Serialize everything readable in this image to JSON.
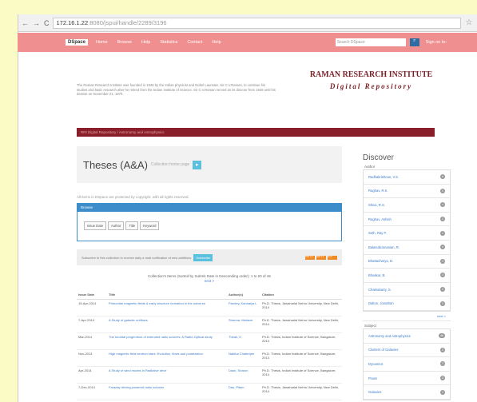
{
  "browser": {
    "host": "172.16.1.22",
    "path": ":8080/jspui/handle/2289/3196"
  },
  "navbar": {
    "logo": "DSpace",
    "links": [
      "Home",
      "Browse",
      "Help",
      "Statistics",
      "Contact",
      "Help"
    ],
    "search_placeholder": "Search DSpace",
    "signin": "Sign on to:"
  },
  "intro": {
    "text": "The Raman Research Institute was founded in 1948 by the Indian physicist and Nobel Laureate, Sir C.V.Raman, to continue his studies and basic research after he retired from the Indian Institute of Science. Sir C.V.Raman served as its director from 1948 until his demise on November 21, 1970."
  },
  "brand": {
    "line1": "RAMAN RESEARCH INSTITUTE",
    "line2": "Digital Repository"
  },
  "breadcrumb": "RRI Digital Repository / Astronomy and Astrophysics",
  "collection": {
    "title": "Theses (A&A)",
    "subtitle": "Collection home page"
  },
  "notice": "All items in DSpace are protected by copyright, with all rights reserved.",
  "browse": {
    "header": "Browse",
    "buttons": [
      "Issue Date",
      "Author",
      "Title",
      "Keyword"
    ]
  },
  "subscribe": {
    "text": "Subscribe to this collection to receive daily e-mail notification of new additions",
    "button": "Subscribe",
    "feeds": [
      "RSS 1.0",
      "RSS 2.0",
      "Atom"
    ]
  },
  "listing": {
    "summary": "Collection's Items (Sorted by Submit Date in Descending order): 1 to 20 of 46",
    "next": "next >"
  },
  "table": {
    "headers": [
      "Issue Date",
      "Title",
      "Author(s)",
      "Citation"
    ],
    "rows": [
      [
        "15-Apr-2014",
        "Primordial magnetic fields & early structure formation in the universe",
        "Pandey, Kanhaiya L",
        "Ph.D. Thesis, Jawaharlal Nehru University, New Delhi, 2014"
      ],
      [
        "7-Apr-2014",
        "A Study of galactic outflows",
        "Sharma, Mahavir",
        "Ph.D. Thesis, Jawaharlal Nehru University, New Delhi, 2014"
      ],
      [
        "Mar-2014",
        "The toroidal progenitors of extended radio sources: A Radio-Optical study",
        "Thirak, K.",
        "Ph.D. Thesis, Indian Institute of Science, Bangalore, 2014"
      ],
      [
        "Nov-2013",
        "High magnetic field neutron stars: Evolution, flows and polarization",
        "Nabiha Chatterjee",
        "Ph.D. Thesis, Indian Institute of Science, Bangalore, 2013"
      ],
      [
        "Apr-2014",
        "A Study of wind modes in Radiative drive",
        "Dash, Sharon",
        "Ph.D. Thesis, Indian Institute of Science, Bangalore, 2014"
      ],
      [
        "7-Dec-2014",
        "Faraday driving powered radio sources",
        "Das, Pitam",
        "Ph.D. Thesis, Jawaharlal Nehru University, New Delhi, 2014"
      ]
    ]
  },
  "discover": {
    "heading": "Discover",
    "author_label": "Author",
    "authors": [
      {
        "name": "Radhakrishnan, V.S.",
        "count": "6"
      },
      {
        "name": "Raghav, R.K.",
        "count": "5"
      },
      {
        "name": "Shiva, R.S.",
        "count": "4"
      },
      {
        "name": "Raghav, Ashish",
        "count": "4"
      },
      {
        "name": "Seth, Ray P.",
        "count": "4"
      },
      {
        "name": "Balasubramanian, R.",
        "count": "4"
      },
      {
        "name": "Bhattacharya, D.",
        "count": "3"
      },
      {
        "name": "Bhaskar, B.",
        "count": "3"
      },
      {
        "name": "Chakrabarty, S.",
        "count": "3"
      },
      {
        "name": "Dalton, Jonathan",
        "count": "3"
      }
    ],
    "more": "next >",
    "subject_label": "Subject",
    "subjects": [
      {
        "name": "Astronomy and Astrophysics",
        "count": "46"
      },
      {
        "name": "Clusters of Galaxies",
        "count": "3"
      },
      {
        "name": "Dynamics",
        "count": "3"
      },
      {
        "name": "Flows",
        "count": "3"
      },
      {
        "name": "Galaxies",
        "count": "3"
      }
    ]
  }
}
